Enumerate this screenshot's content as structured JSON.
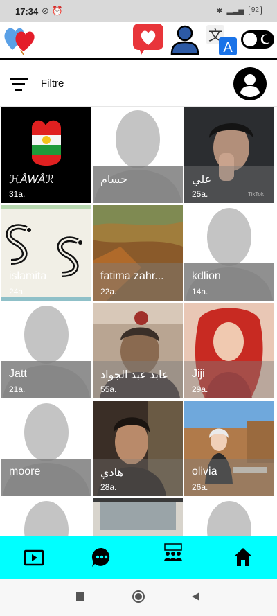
{
  "status": {
    "time": "17:34",
    "battery": "92"
  },
  "filter": {
    "label": "Filtre"
  },
  "profiles": [
    {
      "name": "ℋÂWÂℛ",
      "age": "31a."
    },
    {
      "name": "حسام",
      "age": ""
    },
    {
      "name": "علي",
      "age": "25a."
    },
    {
      "name": "islamita",
      "age": "24a."
    },
    {
      "name": "fatima zahr...",
      "age": "22a."
    },
    {
      "name": "kdlion",
      "age": "14a."
    },
    {
      "name": "Jatt",
      "age": "21a."
    },
    {
      "name": "عابد عبد الجواد",
      "age": "55a."
    },
    {
      "name": "Jiji",
      "age": "29a."
    },
    {
      "name": "moore",
      "age": ""
    },
    {
      "name": "هادي",
      "age": "28a."
    },
    {
      "name": "olivia",
      "age": "26a."
    }
  ],
  "colors": {
    "bottom_nav": "#00ffff",
    "overlay": "#7d7d7d"
  },
  "icons": {
    "nav": [
      "video-play-icon",
      "chat-icon",
      "group-icon",
      "home-icon"
    ]
  }
}
